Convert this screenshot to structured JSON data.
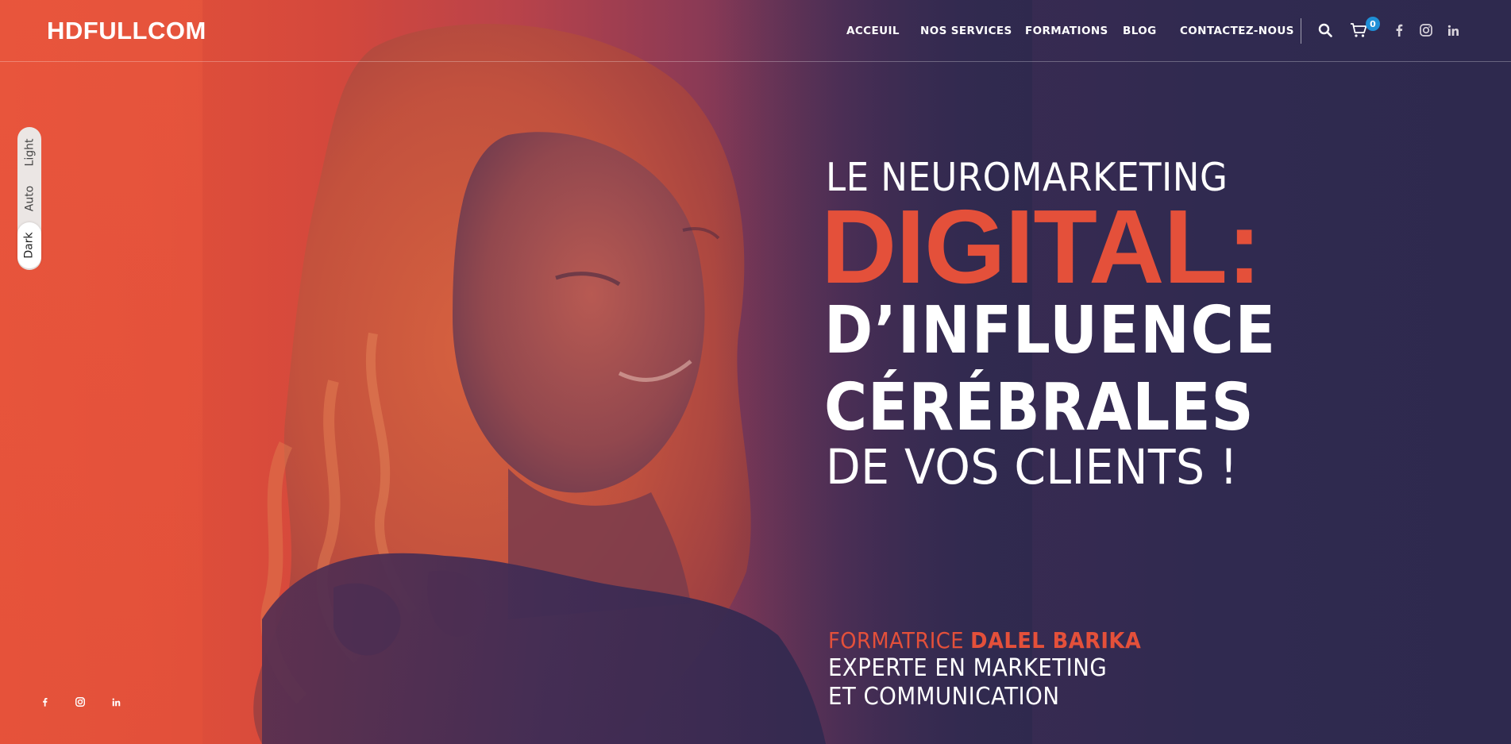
{
  "header": {
    "logo": "HDFULLCOM",
    "nav": [
      {
        "label": "ACCEUIL"
      },
      {
        "label": "NOS SERVICES"
      },
      {
        "label": "FORMATIONS"
      },
      {
        "label": "BLOG"
      },
      {
        "label": "CONTACTEZ-NOUS"
      }
    ],
    "cart_count": "0",
    "icons": [
      "search-icon",
      "cart-icon",
      "facebook-icon",
      "instagram-icon",
      "linkedin-icon"
    ]
  },
  "theme_switch": {
    "options": [
      "Light",
      "Auto",
      "Dark"
    ],
    "selected": "Dark"
  },
  "hero": {
    "line1": "LE NEUROMARKETING",
    "line2": "DIGITAL:",
    "line3": "D’INFLUENCE",
    "line4": "CÉRÉBRALES",
    "line5": "DE VOS CLIENTS !",
    "sub_prefix": "FORMATRICE",
    "sub_name": "DALEL BARIKA",
    "sub_line2": "EXPERTE EN MARKETING",
    "sub_line3": "ET COMMUNICATION"
  },
  "social_bottom": [
    "facebook-icon",
    "instagram-icon",
    "linkedin-icon"
  ],
  "colors": {
    "accent": "#e4503a",
    "hero_dark": "#2e294e",
    "badge": "#1f8fd6"
  }
}
